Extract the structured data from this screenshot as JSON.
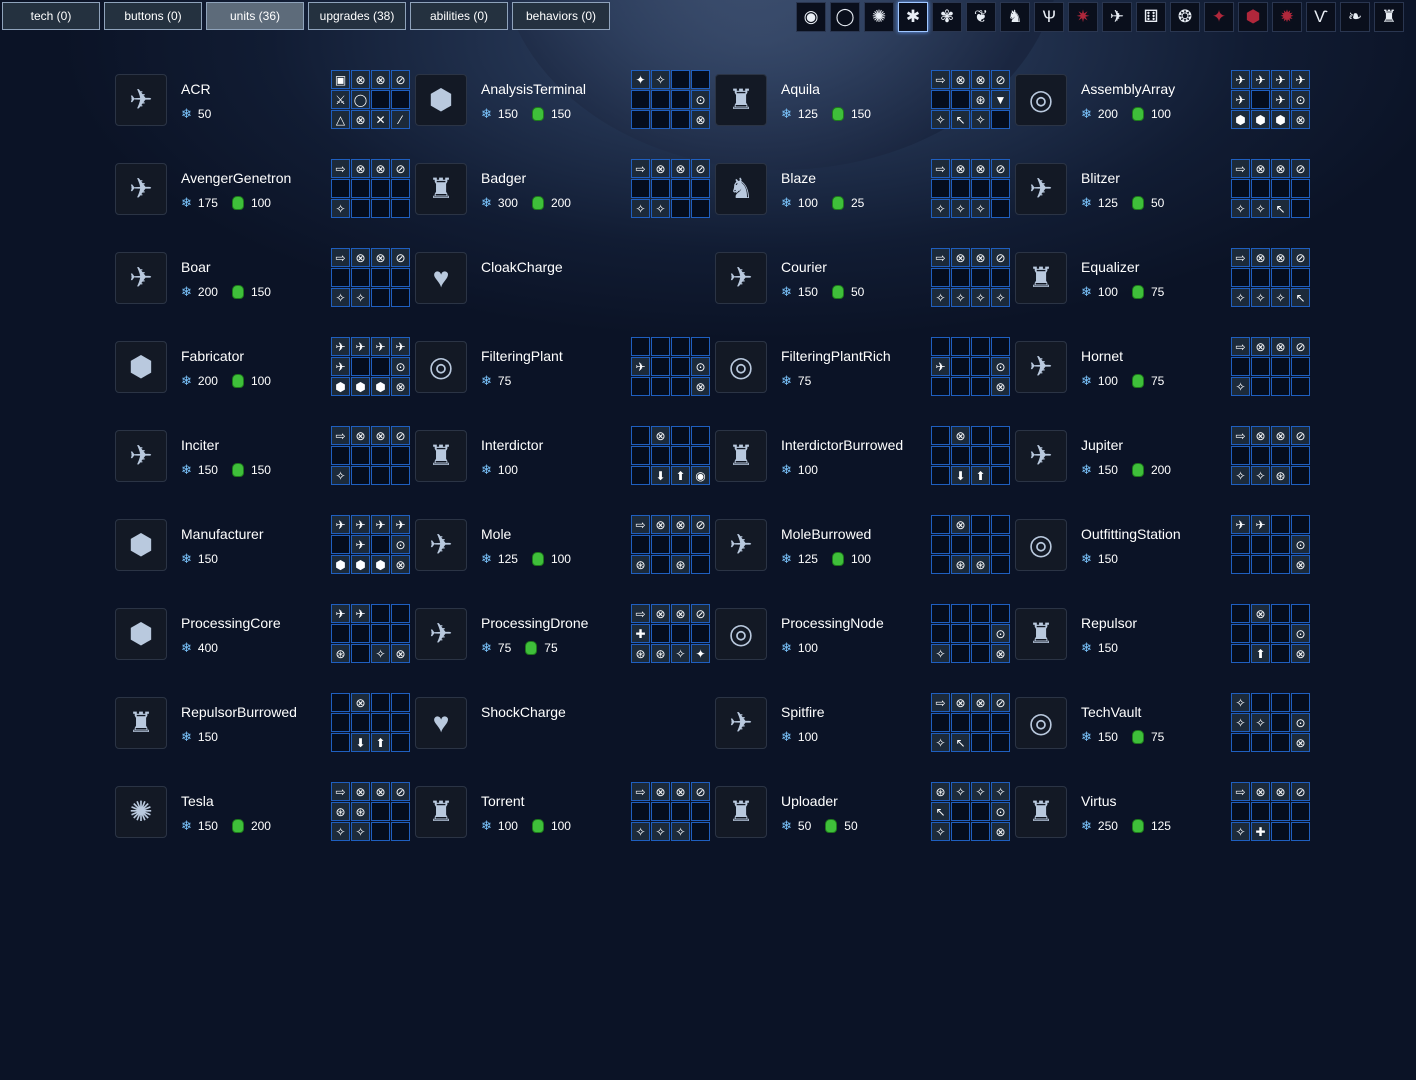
{
  "tabs": [
    {
      "label": "tech (0)",
      "active": false
    },
    {
      "label": "buttons (0)",
      "active": false
    },
    {
      "label": "units (36)",
      "active": true
    },
    {
      "label": "upgrades (38)",
      "active": false
    },
    {
      "label": "abilities (0)",
      "active": false
    },
    {
      "label": "behaviors (0)",
      "active": false
    }
  ],
  "race_icons": [
    {
      "glyph": "◉",
      "name": "race-icon-1",
      "active": false,
      "red": false
    },
    {
      "glyph": "◯",
      "name": "race-icon-2",
      "active": false,
      "red": false
    },
    {
      "glyph": "✺",
      "name": "race-icon-3",
      "active": false,
      "red": false
    },
    {
      "glyph": "✱",
      "name": "race-icon-4",
      "active": true,
      "red": false
    },
    {
      "glyph": "✾",
      "name": "race-icon-5",
      "active": false,
      "red": false
    },
    {
      "glyph": "❦",
      "name": "race-icon-6",
      "active": false,
      "red": false
    },
    {
      "glyph": "♞",
      "name": "race-icon-7",
      "active": false,
      "red": false
    },
    {
      "glyph": "Ѱ",
      "name": "race-icon-8",
      "active": false,
      "red": false
    },
    {
      "glyph": "✷",
      "name": "race-icon-9",
      "active": false,
      "red": true
    },
    {
      "glyph": "✈",
      "name": "race-icon-10",
      "active": false,
      "red": false
    },
    {
      "glyph": "⚅",
      "name": "race-icon-11",
      "active": false,
      "red": false
    },
    {
      "glyph": "❂",
      "name": "race-icon-12",
      "active": false,
      "red": false
    },
    {
      "glyph": "✦",
      "name": "race-icon-13",
      "active": false,
      "red": true
    },
    {
      "glyph": "⬢",
      "name": "race-icon-14",
      "active": false,
      "red": true
    },
    {
      "glyph": "✹",
      "name": "race-icon-15",
      "active": false,
      "red": true
    },
    {
      "glyph": "Ѵ",
      "name": "race-icon-16",
      "active": false,
      "red": false
    },
    {
      "glyph": "❧",
      "name": "race-icon-17",
      "active": false,
      "red": false
    },
    {
      "glyph": "♜",
      "name": "race-icon-18",
      "active": false,
      "red": false
    }
  ],
  "units": [
    {
      "name": "ACR",
      "minerals": "50",
      "gas": "",
      "glyph": "✈",
      "buttons": [
        "▣",
        "⊗",
        "⊗",
        "⊘",
        "⚔",
        "◯",
        "",
        "",
        "△",
        "⊗",
        "✕",
        "⁄"
      ]
    },
    {
      "name": "AnalysisTerminal",
      "minerals": "150",
      "gas": "150",
      "glyph": "⬢",
      "buttons": [
        "✦",
        "✧",
        "",
        "",
        "",
        "",
        "",
        "⊙",
        "",
        "",
        "",
        "⊗"
      ]
    },
    {
      "name": "Aquila",
      "minerals": "125",
      "gas": "150",
      "glyph": "♜",
      "buttons": [
        "⇨",
        "⊗",
        "⊗",
        "⊘",
        "",
        "",
        "⊛",
        "▼",
        "✧",
        "↖",
        "✧",
        ""
      ]
    },
    {
      "name": "AssemblyArray",
      "minerals": "200",
      "gas": "100",
      "glyph": "◎",
      "buttons": [
        "✈",
        "✈",
        "✈",
        "✈",
        "✈",
        "",
        "✈",
        "⊙",
        "⬢",
        "⬢",
        "⬢",
        "⊗"
      ]
    },
    {
      "name": "AvengerGenetron",
      "minerals": "175",
      "gas": "100",
      "glyph": "✈",
      "buttons": [
        "⇨",
        "⊗",
        "⊗",
        "⊘",
        "",
        "",
        "",
        "",
        "✧",
        "",
        "",
        ""
      ]
    },
    {
      "name": "Badger",
      "minerals": "300",
      "gas": "200",
      "glyph": "♜",
      "buttons": [
        "⇨",
        "⊗",
        "⊗",
        "⊘",
        "",
        "",
        "",
        "",
        "✧",
        "✧",
        "",
        ""
      ]
    },
    {
      "name": "Blaze",
      "minerals": "100",
      "gas": "25",
      "glyph": "♞",
      "buttons": [
        "⇨",
        "⊗",
        "⊗",
        "⊘",
        "",
        "",
        "",
        "",
        "✧",
        "✧",
        "✧",
        ""
      ]
    },
    {
      "name": "Blitzer",
      "minerals": "125",
      "gas": "50",
      "glyph": "✈",
      "buttons": [
        "⇨",
        "⊗",
        "⊗",
        "⊘",
        "",
        "",
        "",
        "",
        "✧",
        "✧",
        "↖",
        ""
      ]
    },
    {
      "name": "Boar",
      "minerals": "200",
      "gas": "150",
      "glyph": "✈",
      "buttons": [
        "⇨",
        "⊗",
        "⊗",
        "⊘",
        "",
        "",
        "",
        "",
        "✧",
        "✧",
        "",
        ""
      ]
    },
    {
      "name": "CloakCharge",
      "minerals": "",
      "gas": "",
      "glyph": "♥",
      "buttons": []
    },
    {
      "name": "Courier",
      "minerals": "150",
      "gas": "50",
      "glyph": "✈",
      "buttons": [
        "⇨",
        "⊗",
        "⊗",
        "⊘",
        "",
        "",
        "",
        "",
        "✧",
        "✧",
        "✧",
        "✧"
      ]
    },
    {
      "name": "Equalizer",
      "minerals": "100",
      "gas": "75",
      "glyph": "♜",
      "buttons": [
        "⇨",
        "⊗",
        "⊗",
        "⊘",
        "",
        "",
        "",
        "",
        "✧",
        "✧",
        "✧",
        "↖"
      ]
    },
    {
      "name": "Fabricator",
      "minerals": "200",
      "gas": "100",
      "glyph": "⬢",
      "buttons": [
        "✈",
        "✈",
        "✈",
        "✈",
        "✈",
        "",
        "",
        "⊙",
        "⬢",
        "⬢",
        "⬢",
        "⊗"
      ]
    },
    {
      "name": "FilteringPlant",
      "minerals": "75",
      "gas": "",
      "glyph": "◎",
      "buttons": [
        "",
        "",
        "",
        "",
        "✈",
        "",
        "",
        "⊙",
        "",
        "",
        "",
        "⊗"
      ]
    },
    {
      "name": "FilteringPlantRich",
      "minerals": "75",
      "gas": "",
      "glyph": "◎",
      "buttons": [
        "",
        "",
        "",
        "",
        "✈",
        "",
        "",
        "⊙",
        "",
        "",
        "",
        "⊗"
      ]
    },
    {
      "name": "Hornet",
      "minerals": "100",
      "gas": "75",
      "glyph": "✈",
      "buttons": [
        "⇨",
        "⊗",
        "⊗",
        "⊘",
        "",
        "",
        "",
        "",
        "✧",
        "",
        "",
        ""
      ]
    },
    {
      "name": "Inciter",
      "minerals": "150",
      "gas": "150",
      "glyph": "✈",
      "buttons": [
        "⇨",
        "⊗",
        "⊗",
        "⊘",
        "",
        "",
        "",
        "",
        "✧",
        "",
        "",
        ""
      ]
    },
    {
      "name": "Interdictor",
      "minerals": "100",
      "gas": "",
      "glyph": "♜",
      "buttons": [
        "",
        "⊗",
        "",
        "",
        "",
        "",
        "",
        "",
        "",
        "⬇",
        "⬆",
        "◉"
      ]
    },
    {
      "name": "InterdictorBurrowed",
      "minerals": "100",
      "gas": "",
      "glyph": "♜",
      "buttons": [
        "",
        "⊗",
        "",
        "",
        "",
        "",
        "",
        "",
        "",
        "⬇",
        "⬆",
        ""
      ]
    },
    {
      "name": "Jupiter",
      "minerals": "150",
      "gas": "200",
      "glyph": "✈",
      "buttons": [
        "⇨",
        "⊗",
        "⊗",
        "⊘",
        "",
        "",
        "",
        "",
        "✧",
        "✧",
        "⊛",
        ""
      ]
    },
    {
      "name": "Manufacturer",
      "minerals": "150",
      "gas": "",
      "glyph": "⬢",
      "buttons": [
        "✈",
        "✈",
        "✈",
        "✈",
        "",
        "✈",
        "",
        "⊙",
        "⬢",
        "⬢",
        "⬢",
        "⊗"
      ]
    },
    {
      "name": "Mole",
      "minerals": "125",
      "gas": "100",
      "glyph": "✈",
      "buttons": [
        "⇨",
        "⊗",
        "⊗",
        "⊘",
        "",
        "",
        "",
        "",
        "⊛",
        "",
        "⊛",
        ""
      ]
    },
    {
      "name": "MoleBurrowed",
      "minerals": "125",
      "gas": "100",
      "glyph": "✈",
      "buttons": [
        "",
        "⊗",
        "",
        "",
        "",
        "",
        "",
        "",
        "",
        "⊛",
        "⊛",
        ""
      ]
    },
    {
      "name": "OutfittingStation",
      "minerals": "150",
      "gas": "",
      "glyph": "◎",
      "buttons": [
        "✈",
        "✈",
        "",
        "",
        "",
        "",
        "",
        "⊙",
        "",
        "",
        "",
        "⊗"
      ]
    },
    {
      "name": "ProcessingCore",
      "minerals": "400",
      "gas": "",
      "glyph": "⬢",
      "buttons": [
        "✈",
        "✈",
        "",
        "",
        "",
        "",
        "",
        "",
        "⊛",
        "",
        "✧",
        "⊗"
      ]
    },
    {
      "name": "ProcessingDrone",
      "minerals": "75",
      "gas": "75",
      "glyph": "✈",
      "buttons": [
        "⇨",
        "⊗",
        "⊗",
        "⊘",
        "✚",
        "",
        "",
        "",
        "⊛",
        "⊛",
        "✧",
        "✦"
      ]
    },
    {
      "name": "ProcessingNode",
      "minerals": "100",
      "gas": "",
      "glyph": "◎",
      "buttons": [
        "",
        "",
        "",
        "",
        "",
        "",
        "",
        "⊙",
        "✧",
        "",
        "",
        "⊗"
      ]
    },
    {
      "name": "Repulsor",
      "minerals": "150",
      "gas": "",
      "glyph": "♜",
      "buttons": [
        "",
        "⊗",
        "",
        "",
        "",
        "",
        "",
        "⊙",
        "",
        "⬆",
        "",
        "⊗"
      ]
    },
    {
      "name": "RepulsorBurrowed",
      "minerals": "150",
      "gas": "",
      "glyph": "♜",
      "buttons": [
        "",
        "⊗",
        "",
        "",
        "",
        "",
        "",
        "",
        "",
        "⬇",
        "⬆",
        ""
      ]
    },
    {
      "name": "ShockCharge",
      "minerals": "",
      "gas": "",
      "glyph": "♥",
      "buttons": []
    },
    {
      "name": "Spitfire",
      "minerals": "100",
      "gas": "",
      "glyph": "✈",
      "buttons": [
        "⇨",
        "⊗",
        "⊗",
        "⊘",
        "",
        "",
        "",
        "",
        "✧",
        "↖",
        "",
        ""
      ]
    },
    {
      "name": "TechVault",
      "minerals": "150",
      "gas": "75",
      "glyph": "◎",
      "buttons": [
        "✧",
        "",
        "",
        "",
        "✧",
        "✧",
        "",
        "⊙",
        "",
        "",
        "",
        "⊗"
      ]
    },
    {
      "name": "Tesla",
      "minerals": "150",
      "gas": "200",
      "glyph": "✺",
      "buttons": [
        "⇨",
        "⊗",
        "⊗",
        "⊘",
        "⊛",
        "⊛",
        "",
        "",
        "✧",
        "✧",
        "",
        ""
      ]
    },
    {
      "name": "Torrent",
      "minerals": "100",
      "gas": "100",
      "glyph": "♜",
      "buttons": [
        "⇨",
        "⊗",
        "⊗",
        "⊘",
        "",
        "",
        "",
        "",
        "✧",
        "✧",
        "✧",
        ""
      ]
    },
    {
      "name": "Uploader",
      "minerals": "50",
      "gas": "50",
      "glyph": "♜",
      "buttons": [
        "⊛",
        "✧",
        "✧",
        "✧",
        "↖",
        "",
        "",
        "⊙",
        "✧",
        "",
        "",
        "⊗"
      ]
    },
    {
      "name": "Virtus",
      "minerals": "250",
      "gas": "125",
      "glyph": "♜",
      "buttons": [
        "⇨",
        "⊗",
        "⊗",
        "⊘",
        "",
        "",
        "",
        "",
        "✧",
        "✚",
        "",
        ""
      ]
    }
  ]
}
